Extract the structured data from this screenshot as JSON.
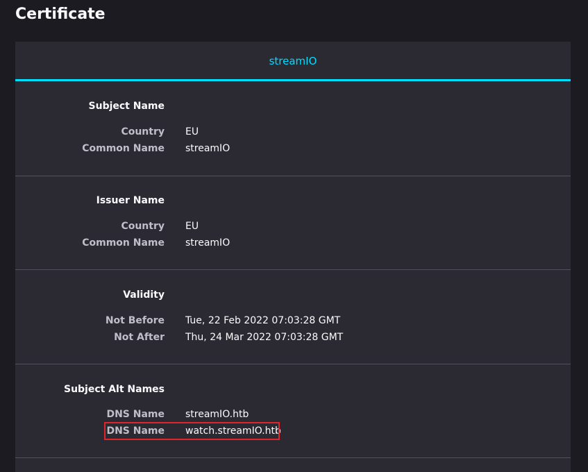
{
  "page": {
    "title": "Certificate"
  },
  "tab": {
    "label": "streamIO"
  },
  "sections": {
    "subject": {
      "heading": "Subject Name",
      "rows": [
        {
          "label": "Country",
          "value": "EU"
        },
        {
          "label": "Common Name",
          "value": "streamIO"
        }
      ]
    },
    "issuer": {
      "heading": "Issuer Name",
      "rows": [
        {
          "label": "Country",
          "value": "EU"
        },
        {
          "label": "Common Name",
          "value": "streamIO"
        }
      ]
    },
    "validity": {
      "heading": "Validity",
      "rows": [
        {
          "label": "Not Before",
          "value": "Tue, 22 Feb 2022 07:03:28 GMT"
        },
        {
          "label": "Not After",
          "value": "Thu, 24 Mar 2022 07:03:28 GMT"
        }
      ]
    },
    "alt_names": {
      "heading": "Subject Alt Names",
      "rows": [
        {
          "label": "DNS Name",
          "value": "streamIO.htb"
        },
        {
          "label": "DNS Name",
          "value": "watch.streamIO.htb",
          "highlighted": true
        }
      ]
    }
  },
  "colors": {
    "background": "#1c1b22",
    "card": "#2b2a33",
    "accent": "#00ddff",
    "highlight_border": "#e0252b",
    "label": "#bfbfc9",
    "text": "#fbfbfe"
  }
}
